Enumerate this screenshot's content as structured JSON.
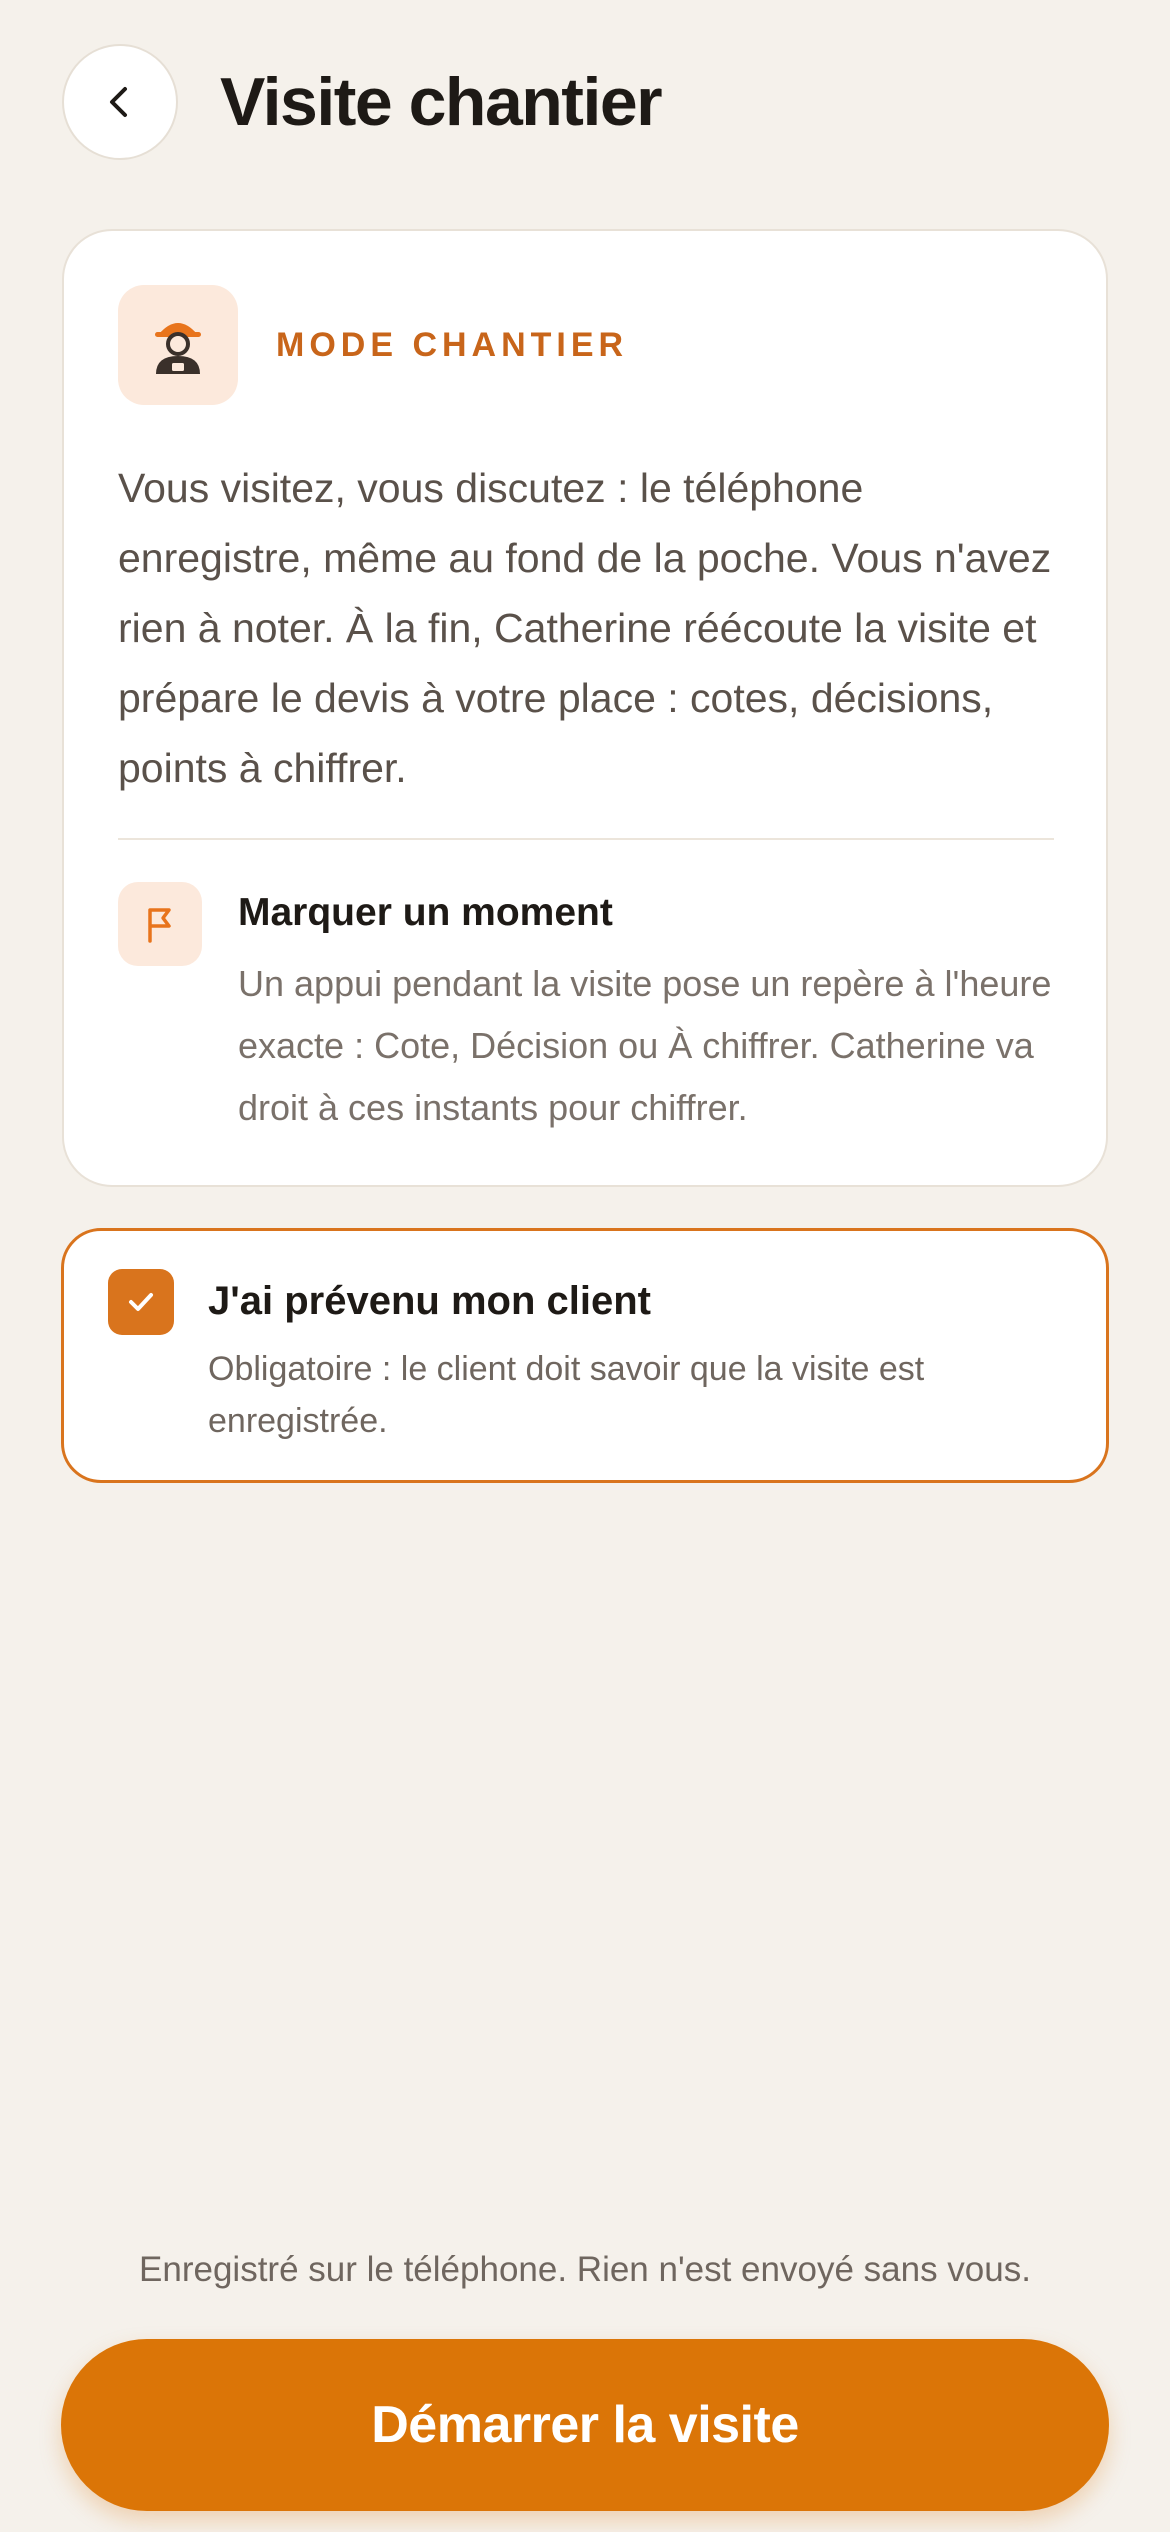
{
  "header": {
    "back_icon": "chevron-left-icon",
    "title": "Visite chantier"
  },
  "card": {
    "mode_icon": "worker-helmet-icon",
    "mode_label": "MODE CHANTIER",
    "description": "Vous visitez, vous discutez : le téléphone enregistre, même au fond de la poche. Vous n'avez rien à noter. À la fin, Catherine réécoute la visite et prépare le devis à votre place : cotes, décisions, points à chiffrer.",
    "moment": {
      "icon": "flag-icon",
      "title": "Marquer un moment",
      "description": "Un appui pendant la visite pose un repère à l'heure exacte : Cote, Décision ou À chiffrer. Catherine va droit à ces instants pour chiffrer."
    }
  },
  "consent": {
    "checked": true,
    "title": "J'ai prévenu mon client",
    "description": "Obligatoire : le client doit savoir que la visite est enregistrée."
  },
  "footer": {
    "note": "Enregistré sur le téléphone. Rien n'est envoyé sans vous.",
    "start_button": "Démarrer la visite"
  },
  "colors": {
    "background": "#F5F1EB",
    "accent": "#DB7507",
    "accent_light": "#FCE9DC",
    "text": "#1E1A16"
  }
}
